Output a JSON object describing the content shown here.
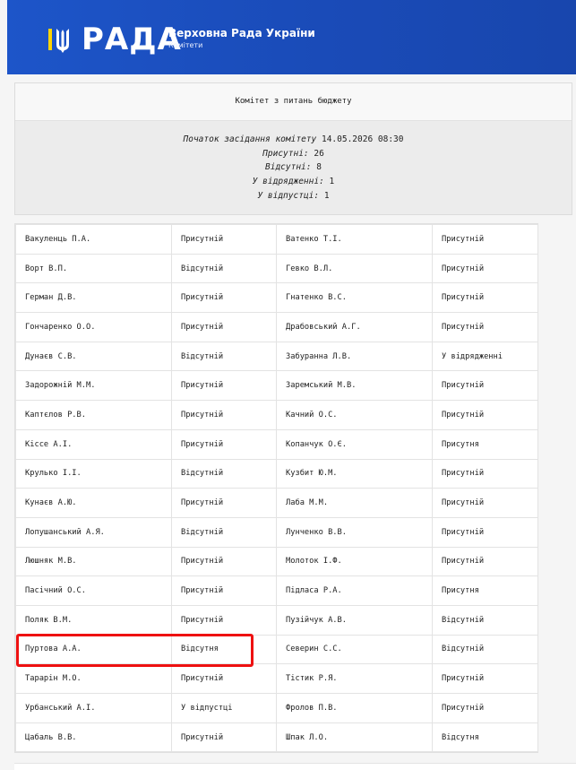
{
  "header": {
    "logo": "РАДА",
    "org_name": "Верховна Рада України",
    "org_sub": "Комітети",
    "logo_icon": "trident-icon"
  },
  "session": {
    "title": "Комітет з питань бюджету",
    "start_label": "Початок засідання комітету",
    "start_value": "14.05.2026 08:30",
    "present_label": "Присутні:",
    "present_value": "26",
    "absent_label": "Відсутні:",
    "absent_value": "8",
    "trip_label": "У відрядженні:",
    "trip_value": "1",
    "vacation_label": "У відпустці:",
    "vacation_value": "1"
  },
  "rows": [
    {
      "n1": "Вакуленць П.А.",
      "s1": "Присутній",
      "n2": "Ватенко Т.І.",
      "s2": "Присутній"
    },
    {
      "n1": "Ворт В.П.",
      "s1": "Відсутній",
      "n2": "Гевко В.Л.",
      "s2": "Присутній"
    },
    {
      "n1": "Герман Д.В.",
      "s1": "Присутній",
      "n2": "Гнатенко В.С.",
      "s2": "Присутній"
    },
    {
      "n1": "Гончаренко О.О.",
      "s1": "Присутній",
      "n2": "Драбовський А.Г.",
      "s2": "Присутній"
    },
    {
      "n1": "Дунаєв С.В.",
      "s1": "Відсутній",
      "n2": "Забуранна Л.В.",
      "s2": "У відрядженні"
    },
    {
      "n1": "Задорожній М.М.",
      "s1": "Присутній",
      "n2": "Заремський М.В.",
      "s2": "Присутній"
    },
    {
      "n1": "Каптєлов Р.В.",
      "s1": "Присутній",
      "n2": "Качний О.С.",
      "s2": "Присутній"
    },
    {
      "n1": "Кіссе А.І.",
      "s1": "Присутній",
      "n2": "Копанчук О.Є.",
      "s2": "Присутня"
    },
    {
      "n1": "Крулько І.І.",
      "s1": "Відсутній",
      "n2": "Кузбит Ю.М.",
      "s2": "Присутній"
    },
    {
      "n1": "Кунаєв А.Ю.",
      "s1": "Присутній",
      "n2": "Лаба М.М.",
      "s2": "Присутній"
    },
    {
      "n1": "Лопушанський А.Я.",
      "s1": "Відсутній",
      "n2": "Лунченко В.В.",
      "s2": "Присутній"
    },
    {
      "n1": "Люшняк М.В.",
      "s1": "Присутній",
      "n2": "Молоток І.Ф.",
      "s2": "Присутній"
    },
    {
      "n1": "Пасічний О.С.",
      "s1": "Присутній",
      "n2": "Підласа Р.А.",
      "s2": "Присутня"
    },
    {
      "n1": "Поляк В.М.",
      "s1": "Присутній",
      "n2": "Пузійчук А.В.",
      "s2": "Відсутній"
    },
    {
      "n1": "Пуртова А.А.",
      "s1": "Відсутня",
      "n2": "Северин С.С.",
      "s2": "Відсутній"
    },
    {
      "n1": "Тарарін М.О.",
      "s1": "Присутній",
      "n2": "Тістик Р.Я.",
      "s2": "Присутній"
    },
    {
      "n1": "Урбанський А.І.",
      "s1": "У відпустці",
      "n2": "Фролов П.В.",
      "s2": "Присутній"
    },
    {
      "n1": "Цабаль В.В.",
      "s1": "Присутній",
      "n2": "Шпак Л.О.",
      "s2": "Відсутня"
    }
  ],
  "colors": {
    "header_blue": "#1d55c9",
    "highlight_red": "#ee1111",
    "accent_yellow": "#ffd500"
  }
}
